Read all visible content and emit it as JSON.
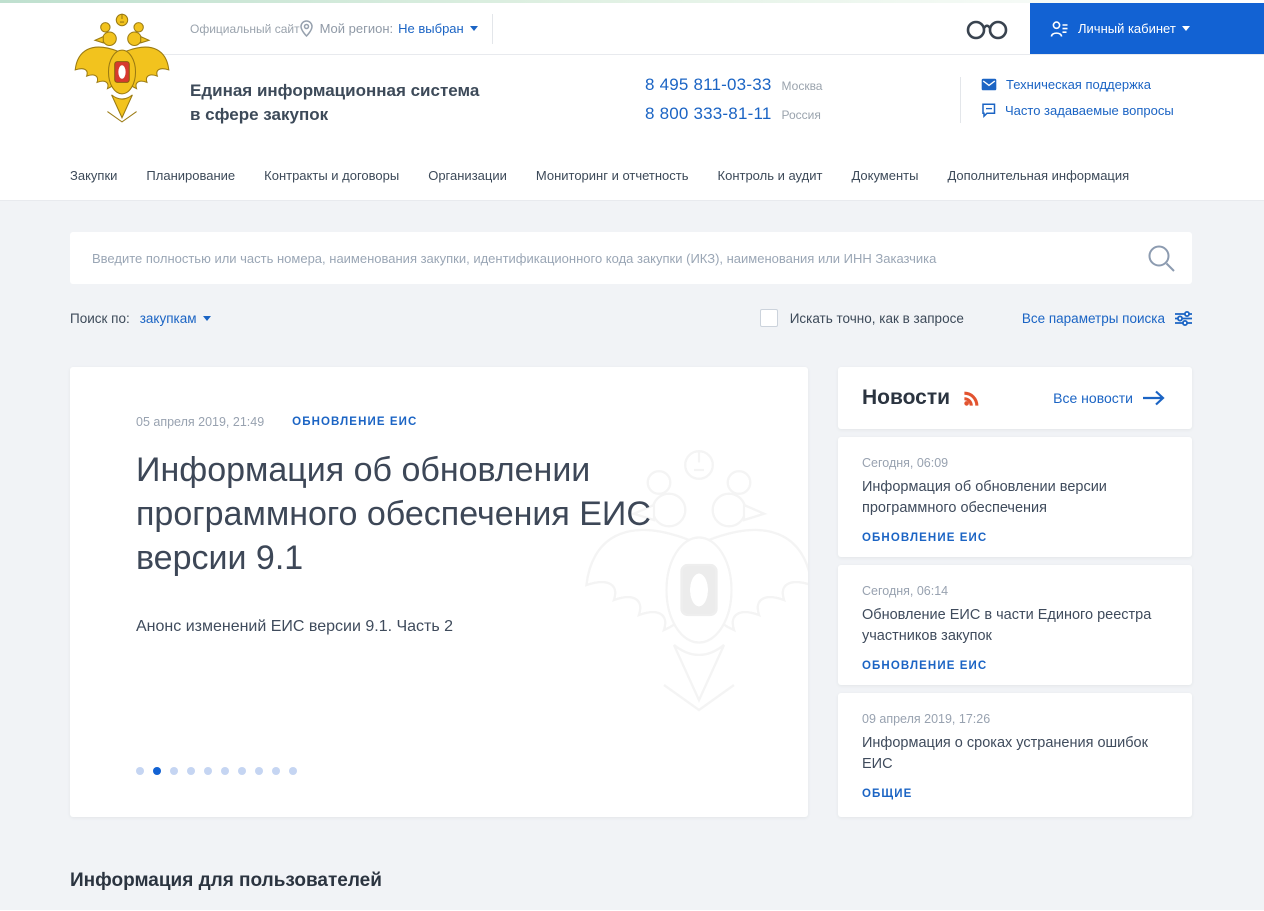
{
  "colors": {
    "link_blue": "#1b64c4",
    "button_blue": "#1262d3",
    "dark_text": "#3d4a59",
    "muted_text": "#98a2b0",
    "bg_gray": "#f1f3f6",
    "rss_orange": "#e2532f",
    "eagle_gold": "#f2c31e",
    "shield_red": "#d7392f"
  },
  "icons": [
    "coat-of-arms-logo",
    "location-pin-icon",
    "caret-down-icon",
    "glasses-icon",
    "user-icon",
    "mail-icon",
    "faq-icon",
    "search-icon",
    "filter-sliders-icon",
    "rss-icon",
    "arrow-right-icon"
  ],
  "topbar": {
    "official_site": "Официальный сайт",
    "region_label": "Мой регион:",
    "region_value": "Не выбран",
    "account_label": "Личный кабинет"
  },
  "header": {
    "title_line1": "Единая информационная система",
    "title_line2": "в сфере закупок",
    "phones": [
      {
        "number": "8 495 811-03-33",
        "region": "Москва"
      },
      {
        "number": "8 800 333-81-11",
        "region": "Россия"
      }
    ],
    "links": [
      {
        "label": "Техническая поддержка"
      },
      {
        "label": "Часто задаваемые вопросы"
      }
    ]
  },
  "nav": {
    "items": [
      "Закупки",
      "Планирование",
      "Контракты и договоры",
      "Организации",
      "Мониторинг и отчетность",
      "Контроль и аудит",
      "Документы",
      "Дополнительная информация"
    ]
  },
  "search": {
    "placeholder": "Введите полностью или часть номера, наименования закупки, идентификационного кода закупки (ИКЗ), наименования или ИНН Заказчика",
    "scope_label": "Поиск по:",
    "scope_value": "закупкам",
    "exact_label": "Искать точно, как в запросе",
    "all_params_label": "Все параметры поиска"
  },
  "carousel": {
    "date": "05 апреля 2019, 21:49",
    "tag": "ОБНОВЛЕНИЕ ЕИС",
    "title": "Информация об обновлении программного обеспечения ЕИС версии 9.1",
    "subtitle": "Анонс изменений ЕИС версии 9.1. Часть 2",
    "dots_total": 10,
    "active_dot": 2
  },
  "news": {
    "title": "Новости",
    "all_label": "Все новости",
    "items": [
      {
        "date": "Сегодня, 06:09",
        "title": "Информация об обновлении версии программного обеспечения",
        "tag": "ОБНОВЛЕНИЕ ЕИС"
      },
      {
        "date": "Сегодня, 06:14",
        "title": "Обновление ЕИС в части Единого реестра участников закупок",
        "tag": "ОБНОВЛЕНИЕ ЕИС"
      },
      {
        "date": "09 апреля 2019, 17:26",
        "title": "Информация о сроках устранения ошибок ЕИС",
        "tag": "ОБЩИЕ"
      }
    ]
  },
  "sections": {
    "users_info_title": "Информация для пользователей"
  }
}
